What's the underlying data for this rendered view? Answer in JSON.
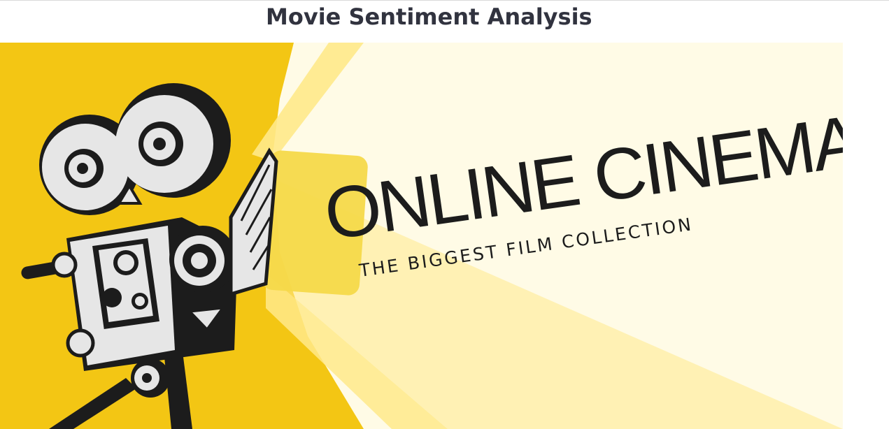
{
  "page": {
    "title": "Movie Sentiment Analysis"
  },
  "banner": {
    "headline": "ONLINE CINEMA",
    "tagline": "THE BIGGEST FILM COLLECTION",
    "colors": {
      "yellow": "#f3c614",
      "cream": "#fffbe6",
      "light_beam": "#ffe98a",
      "ink": "#1c1c1c",
      "camera_light": "#e6e6e6"
    },
    "icons": [
      "film-camera-icon",
      "projector-light-beam"
    ]
  }
}
